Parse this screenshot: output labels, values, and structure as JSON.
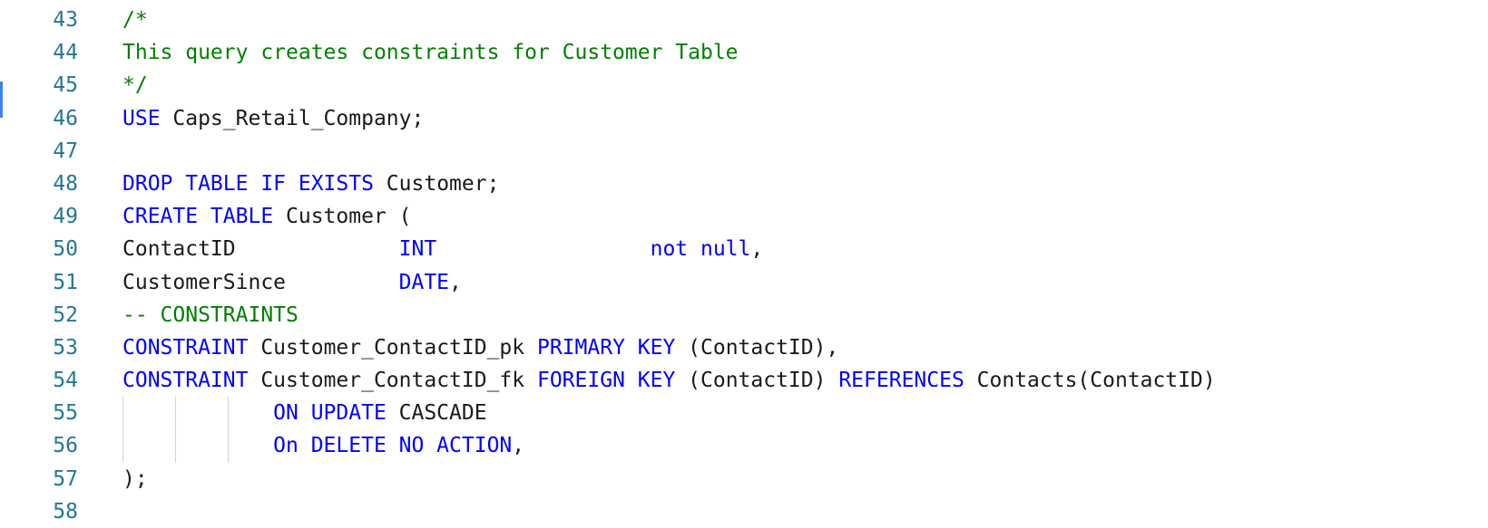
{
  "colors": {
    "line_number": "#237893",
    "keyword": "#0000ff",
    "comment": "#008000",
    "text": "#1a1a1a",
    "active_marker": "#3d7ff5",
    "indent_guide": "#d3d3d3"
  },
  "lines": [
    {
      "n": "43",
      "tokens": [
        {
          "t": "cm",
          "v": "/*"
        }
      ]
    },
    {
      "n": "44",
      "tokens": [
        {
          "t": "cm",
          "v": "This query creates constraints for Customer Table"
        }
      ]
    },
    {
      "n": "45",
      "tokens": [
        {
          "t": "cm",
          "v": "*/"
        }
      ]
    },
    {
      "n": "46",
      "tokens": [
        {
          "t": "kw",
          "v": "USE"
        },
        {
          "t": "tx",
          "v": " Caps_Retail_Company;"
        }
      ]
    },
    {
      "n": "47",
      "tokens": []
    },
    {
      "n": "48",
      "tokens": [
        {
          "t": "kw",
          "v": "DROP TABLE IF EXISTS"
        },
        {
          "t": "tx",
          "v": " Customer;"
        }
      ]
    },
    {
      "n": "49",
      "tokens": [
        {
          "t": "kw",
          "v": "CREATE TABLE"
        },
        {
          "t": "tx",
          "v": " Customer ("
        }
      ]
    },
    {
      "n": "50",
      "tokens": [
        {
          "t": "tx",
          "v": "ContactID             "
        },
        {
          "t": "kw",
          "v": "INT"
        },
        {
          "t": "tx",
          "v": "                 "
        },
        {
          "t": "kw",
          "v": "not null"
        },
        {
          "t": "tx",
          "v": ","
        }
      ]
    },
    {
      "n": "51",
      "tokens": [
        {
          "t": "tx",
          "v": "CustomerSince         "
        },
        {
          "t": "kw",
          "v": "DATE"
        },
        {
          "t": "tx",
          "v": ","
        }
      ]
    },
    {
      "n": "52",
      "tokens": [
        {
          "t": "cm",
          "v": "-- CONSTRAINTS"
        }
      ]
    },
    {
      "n": "53",
      "tokens": [
        {
          "t": "kw",
          "v": "CONSTRAINT"
        },
        {
          "t": "tx",
          "v": " Customer_ContactID_pk "
        },
        {
          "t": "kw",
          "v": "PRIMARY KEY"
        },
        {
          "t": "tx",
          "v": " (ContactID),"
        }
      ]
    },
    {
      "n": "54",
      "tokens": [
        {
          "t": "kw",
          "v": "CONSTRAINT"
        },
        {
          "t": "tx",
          "v": " Customer_ContactID_fk "
        },
        {
          "t": "kw",
          "v": "FOREIGN KEY"
        },
        {
          "t": "tx",
          "v": " (ContactID) "
        },
        {
          "t": "kw",
          "v": "REFERENCES"
        },
        {
          "t": "tx",
          "v": " Contacts(ContactID)"
        }
      ]
    },
    {
      "n": "55",
      "tokens": [
        {
          "t": "tx",
          "v": "            "
        },
        {
          "t": "kw",
          "v": "ON UPDATE"
        },
        {
          "t": "tx",
          "v": " CASCADE"
        }
      ]
    },
    {
      "n": "56",
      "tokens": [
        {
          "t": "tx",
          "v": "            "
        },
        {
          "t": "kw",
          "v": "On DELETE NO ACTION"
        },
        {
          "t": "tx",
          "v": ","
        }
      ]
    },
    {
      "n": "57",
      "tokens": [
        {
          "t": "tx",
          "v": ");"
        }
      ]
    },
    {
      "n": "58",
      "tokens": []
    }
  ]
}
